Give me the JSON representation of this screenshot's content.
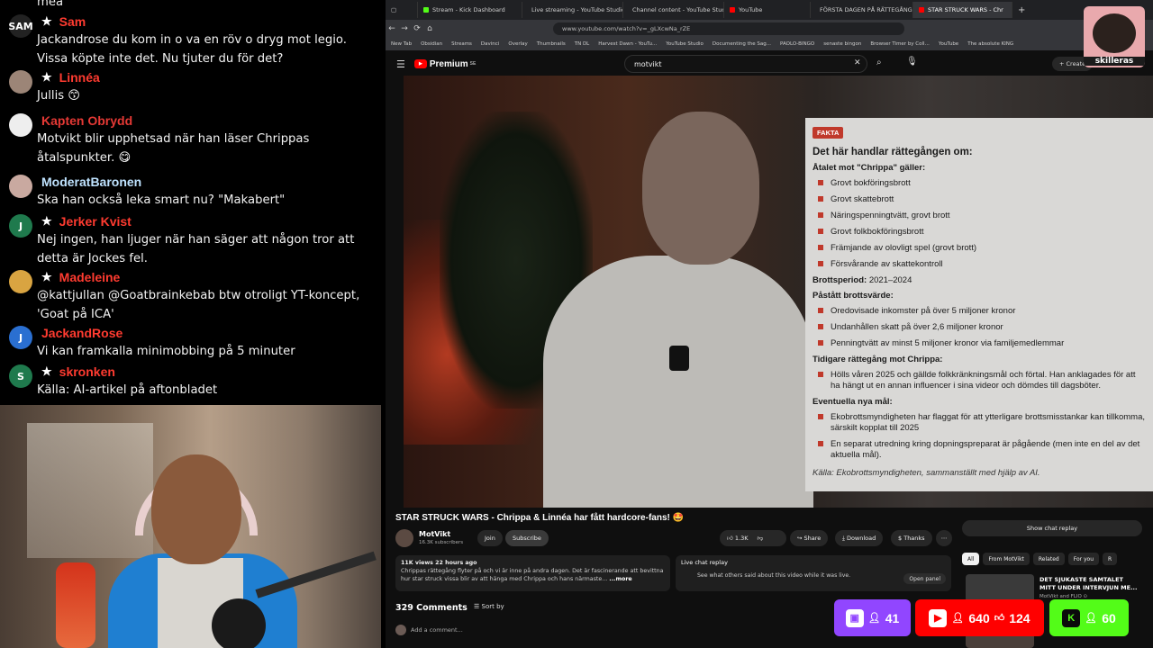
{
  "chat": {
    "messages": [
      {
        "name": "",
        "star": false,
        "text": "mea",
        "avatar": "",
        "color": "#ff4d4d",
        "avatar_bg": "#000000"
      },
      {
        "name": "Sam",
        "star": true,
        "text": "Jackandrose du kom in o va en röv o dryg mot legio. Vissa köpte inte det. Nu tjuter du för det?",
        "avatar": "SAM",
        "color": "#ff3b30",
        "avatar_bg": "#222222"
      },
      {
        "name": "Linnéa",
        "star": true,
        "text": "Jullis 😙",
        "avatar": "",
        "color": "#ff3b30",
        "avatar_bg": "#9c8577"
      },
      {
        "name": "Kapten Obrydd",
        "star": false,
        "text": "Motvikt blir upphetsad när han läser Chrippas åtalspunkter. 😋",
        "avatar": "",
        "color": "#e53935",
        "avatar_bg": "#eeeeee"
      },
      {
        "name": "ModeratBaronen",
        "star": false,
        "text": "Ska han också leka smart nu? \"Makabert\"",
        "avatar": "",
        "color": "#bfe3ff",
        "avatar_bg": "#c9a9a0"
      },
      {
        "name": "Jerker Kvist",
        "star": true,
        "text": "Nej ingen, han ljuger när han säger att någon tror att detta är Jockes fel.",
        "avatar": "J",
        "color": "#ff3b30",
        "avatar_bg": "#1f7a4d"
      },
      {
        "name": "Madeleine",
        "star": true,
        "text": "@kattjullan @Goatbrainkebab btw otroligt YT-koncept, 'Goat på ICA'",
        "avatar": "",
        "color": "#ff3b30",
        "avatar_bg": "#d9a441"
      },
      {
        "name": "JackandRose",
        "star": false,
        "text": "Vi kan framkalla minimobbing på 5 minuter",
        "avatar": "J",
        "color": "#ff3b30",
        "avatar_bg": "#2a6fd1"
      },
      {
        "name": "skronken",
        "star": true,
        "text": "Källa: AI-artikel på aftonbladet",
        "avatar": "S",
        "color": "#ff3b30",
        "avatar_bg": "#1f7a4d"
      }
    ]
  },
  "browser": {
    "tabs": [
      {
        "label": "Stream - Kick Dashboard",
        "color": "#53fc18",
        "active": false
      },
      {
        "label": "Live streaming - YouTube Studio",
        "color": "#ff0000",
        "active": false
      },
      {
        "label": "Channel content - YouTube Studio",
        "color": "#ff0000",
        "active": false
      },
      {
        "label": "YouTube",
        "color": "#ff0000",
        "active": false
      },
      {
        "label": "FÖRSTA DAGEN PÅ RÄTTEGÅNG",
        "color": "#ff0000",
        "active": false
      },
      {
        "label": "STAR STRUCK WARS - Chr",
        "color": "#ff0000",
        "active": true
      }
    ],
    "new_tab": "+",
    "url": "www.youtube.com/watch?v=_gLXcwNa_rZE",
    "bookmarks": [
      "New Tab",
      "Obsidian",
      "Streams",
      "Davinci",
      "Overlay",
      "Thumbnails",
      "TN DL",
      "Harvest Dawn - YouTu...",
      "YouTube Studio",
      "Documenting the Sag...",
      "PAOLO-BINGO",
      "senaste bingon",
      "Browser Timer by Coll...",
      "YouTube",
      "The absolute KING"
    ]
  },
  "youtube": {
    "logo_text": "Premium",
    "logo_sup": "SE",
    "search_value": "motvikt",
    "create_label": "+ Create",
    "video_title": "STAR STRUCK WARS - Chrippa & Linnéa har fått hardcore-fans! 🤩",
    "channel": {
      "name": "MotVikt",
      "subs": "16.3K subscribers"
    },
    "join_label": "Join",
    "subscribe_label": "Subscribe",
    "likes": "1.3K",
    "share_label": "Share",
    "download_label": "Download",
    "thanks_label": "Thanks",
    "more_actions": "⋯",
    "description": {
      "meta": "11K views  22 hours ago",
      "text": "Chrippas rättegång flyter på och vi är inne på andra dagen. Det är fascinerande att bevittna hur star struck vissa blir av att hänga med Chrippa och hans närmaste...",
      "more": "...more"
    },
    "live_replay": {
      "title": "Live chat replay",
      "text": "See what others said about this video while it was live.",
      "button": "Open panel"
    },
    "comments_count": "329 Comments",
    "sort_by": "Sort by",
    "add_comment": "Add a comment...",
    "show_chat_replay": "Show chat replay",
    "chips": [
      "All",
      "From MotVikt",
      "Related",
      "For you",
      "R"
    ],
    "recommendation": {
      "title": "DET SJUKASTE SAMTALET MITT UNDER INTERVJUN ME...",
      "channel": "MotVikt and FLIO ⊙"
    }
  },
  "fact_panel": {
    "badge": "FAKTA",
    "title": "Det här handlar rättegången om:",
    "charges_heading": "Åtalet mot \"Chrippa\" gäller:",
    "charges": [
      "Grovt bokföringsbrott",
      "Grovt skattebrott",
      "Näringspenningtvätt, grovt brott",
      "Grovt folkbokföringsbrott",
      "Främjande av olovligt spel (grovt brott)",
      "Försvårande av skattekontroll"
    ],
    "period_label": "Brottsperiod:",
    "period_value": "2021–2024",
    "value_heading": "Påstått brottsvärde:",
    "values": [
      "Oredovisade inkomster på över 5 miljoner kronor",
      "Undanhållen skatt på över 2,6 miljoner kronor",
      "Penningtvätt av minst 5 miljoner kronor via familjemedlemmar"
    ],
    "earlier_heading": "Tidigare rättegång mot Chrippa:",
    "earlier": [
      "Hölls våren 2025 och gällde folkkränkningsmål och förtal. Han anklagades för att ha hängt ut en annan influencer i sina videor och dömdes till dagsböter."
    ],
    "new_heading": "Eventuella nya mål:",
    "new": [
      "Ekobrottsmyndigheten har flaggat för att ytterligare brottsmisstankar kan tillkomma, särskilt kopplat till 2025",
      "En separat utredning kring dopningspreparat är pågående (men inte en del av det aktuella mål)."
    ],
    "source": "Källa: Ekobrottsmyndigheten, sammanställt med hjälp av AI."
  },
  "overlay": {
    "logo_text": "skilleras",
    "twitch_count": "41",
    "youtube_viewers": "640",
    "youtube_likes": "124",
    "kick_count": "60",
    "twitch_color": "#9146ff",
    "youtube_color": "#ff0000",
    "kick_color": "#53fc18"
  }
}
